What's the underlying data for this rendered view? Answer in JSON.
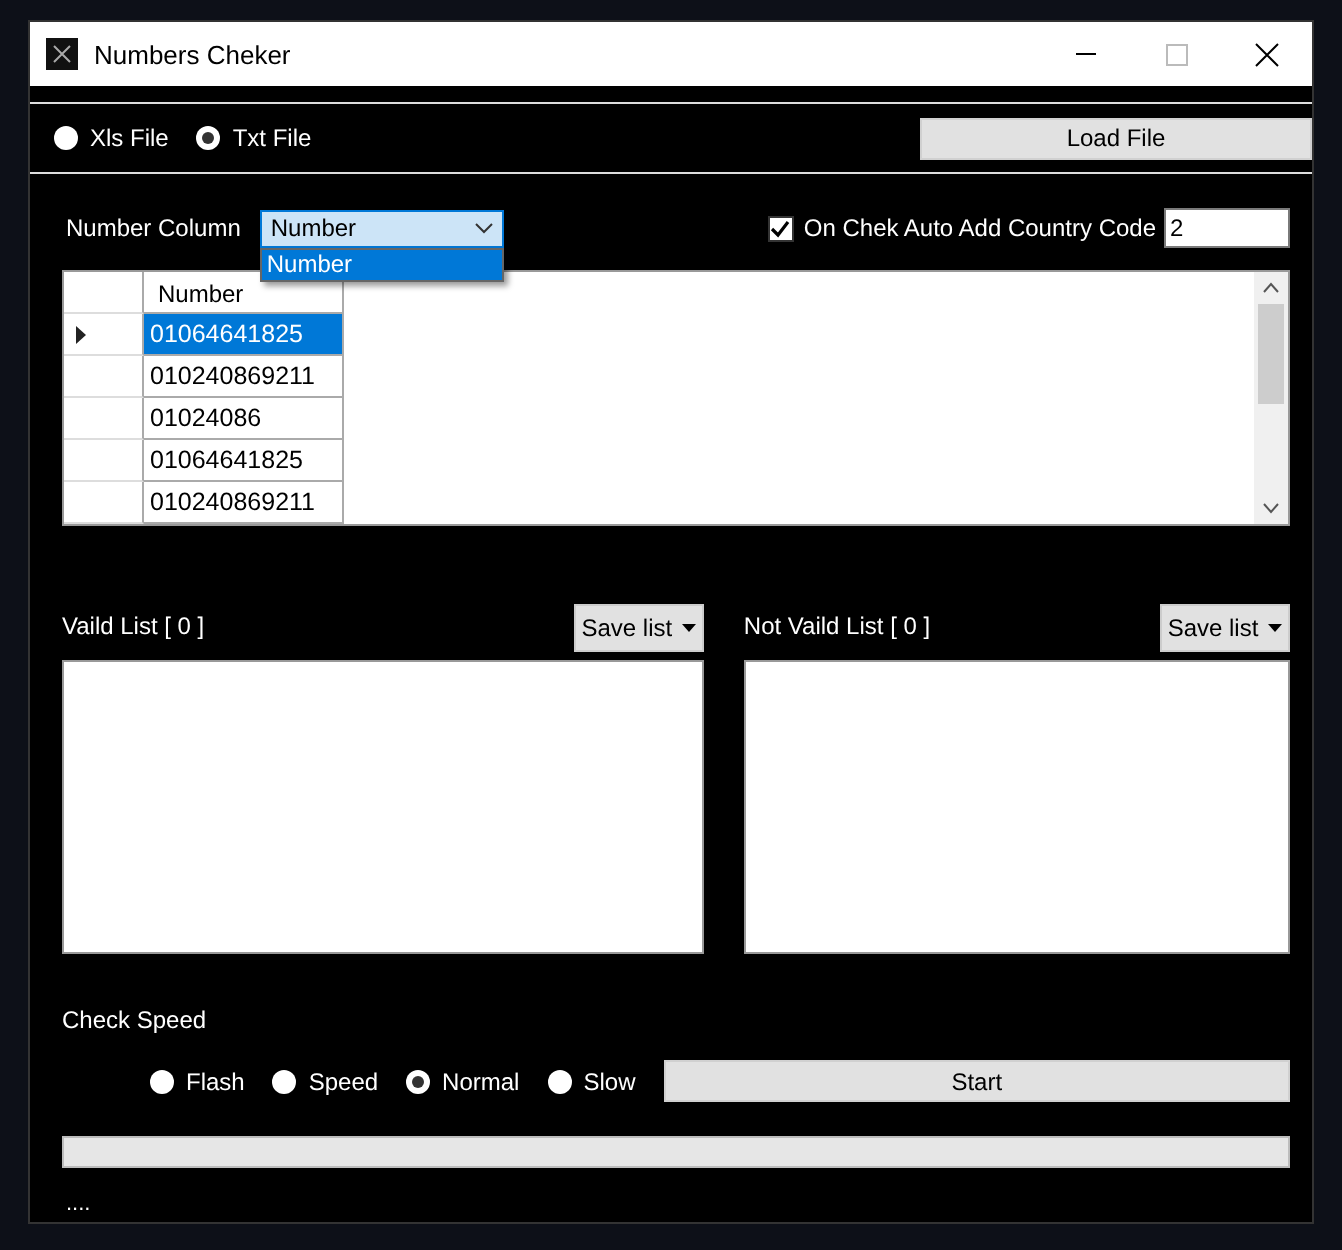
{
  "window": {
    "title": "Numbers Cheker"
  },
  "file_types": [
    {
      "label": "Xls File",
      "selected": false
    },
    {
      "label": "Txt File",
      "selected": true
    }
  ],
  "load_button": "Load File",
  "number_column": {
    "label": "Number Column",
    "value": "Number",
    "expanded": true,
    "options": [
      {
        "label": "Number",
        "selected": true
      }
    ]
  },
  "auto_country_code": {
    "label": "On Chek Auto Add Country Code",
    "checked": true,
    "value": "2"
  },
  "grid": {
    "columns": [
      "Number"
    ],
    "rows": [
      {
        "cells": [
          "01064641825"
        ],
        "selected": true
      },
      {
        "cells": [
          "010240869211"
        ],
        "selected": false
      },
      {
        "cells": [
          "01024086"
        ],
        "selected": false
      },
      {
        "cells": [
          "01064641825"
        ],
        "selected": false
      },
      {
        "cells": [
          "010240869211"
        ],
        "selected": false
      }
    ]
  },
  "valid_list": {
    "label": "Vaild List [ 0 ]",
    "button": "Save list"
  },
  "invalid_list": {
    "label": "Not Vaild List [ 0 ]",
    "button": "Save list"
  },
  "check_speed": {
    "label": "Check Speed",
    "options": [
      {
        "label": "Flash",
        "selected": false
      },
      {
        "label": "Speed",
        "selected": false
      },
      {
        "label": "Normal",
        "selected": true
      },
      {
        "label": "Slow",
        "selected": false
      }
    ]
  },
  "start_button": "Start",
  "progress": {
    "level": 0
  },
  "status": "...."
}
